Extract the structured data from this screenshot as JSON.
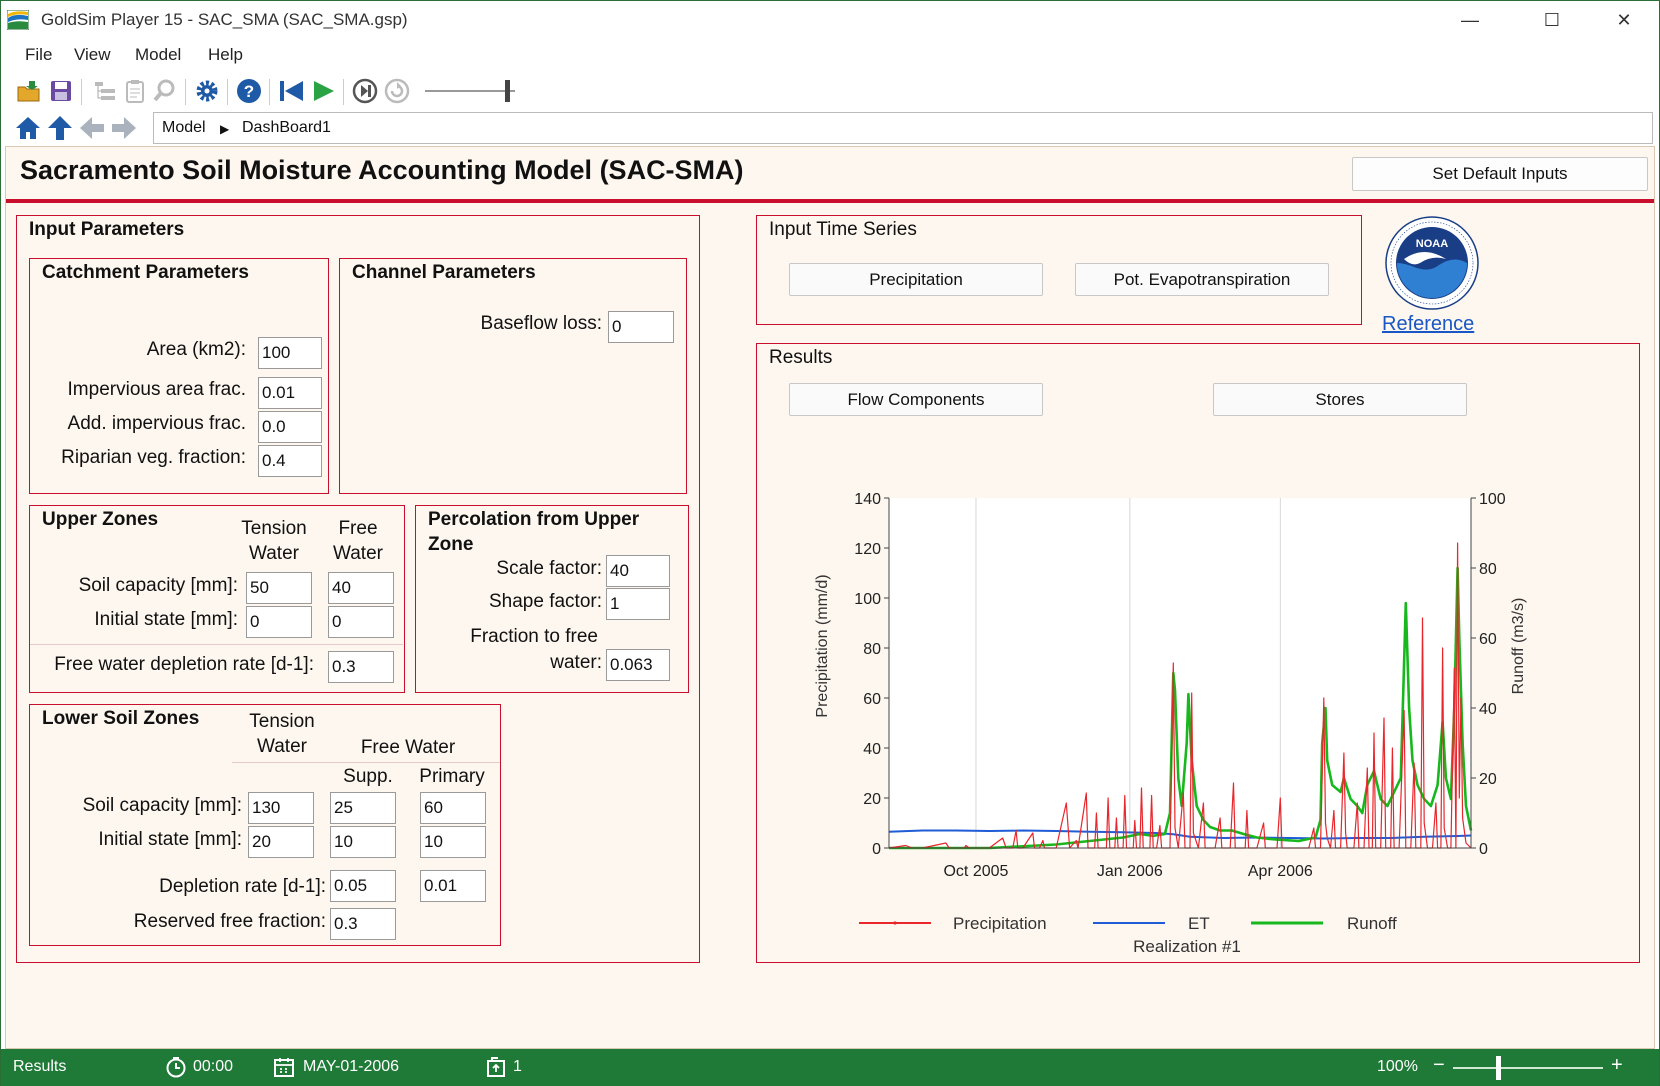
{
  "window": {
    "title": "GoldSim Player 15  - SAC_SMA (SAC_SMA.gsp)",
    "minimize": "—",
    "maximize": "☐",
    "close": "✕"
  },
  "menu": [
    "File",
    "View",
    "Model",
    "Help"
  ],
  "toolbar_icons": [
    "open-folder-icon",
    "save-icon",
    "tree-view-icon",
    "clipboard-icon",
    "search-icon",
    "gear-icon",
    "help-icon",
    "rewind-icon",
    "play-icon",
    "step-icon",
    "reset-icon"
  ],
  "breadcrumb": {
    "root": "Model",
    "separator": "▶",
    "current": "DashBoard1"
  },
  "dashboard": {
    "title": "Sacramento Soil Moisture Accounting Model (SAC-SMA)",
    "set_default_label": "Set Default Inputs",
    "input_parameters": "Input Parameters",
    "catchment": {
      "title": "Catchment Parameters",
      "area_label": "Area (km2):",
      "area": "100",
      "imperv_label": "Impervious area frac.",
      "imperv": "0.01",
      "add_imperv_label": "Add. impervious frac.",
      "add_imperv": "0.0",
      "riparian_label": "Riparian veg. fraction:",
      "riparian": "0.4"
    },
    "channel": {
      "title": "Channel Parameters",
      "baseflow_label": "Baseflow loss:",
      "baseflow": "0"
    },
    "upper": {
      "title": "Upper Zones",
      "col1": "Tension\nWater",
      "col1a": "Tension",
      "col1b": "Water",
      "col2a": "Free",
      "col2b": "Water",
      "soil_label": "Soil capacity [mm]:",
      "soil_tension": "50",
      "soil_free": "40",
      "init_label": "Initial state [mm]:",
      "init_tension": "0",
      "init_free": "0",
      "depl_label": "Free water depletion rate [d-1]:",
      "depl": "0.3"
    },
    "percolation": {
      "title_a": "Percolation from Upper",
      "title_b": "Zone",
      "scale_label": "Scale factor:",
      "scale": "40",
      "shape_label": "Shape factor:",
      "shape": "1",
      "frac_label_a": "Fraction to free",
      "frac_label_b": "water:",
      "frac": "0.063"
    },
    "lower": {
      "title": "Lower Soil Zones",
      "tension_a": "Tension",
      "tension_b": "Water",
      "free_water": "Free Water",
      "supp": "Supp.",
      "primary": "Primary",
      "soil_label": "Soil capacity [mm]:",
      "soil_tension": "130",
      "soil_supp": "25",
      "soil_primary": "60",
      "init_label": "Initial state [mm]:",
      "init_tension": "20",
      "init_supp": "10",
      "init_primary": "10",
      "depl_label": "Depletion rate [d-1]:",
      "depl_supp": "0.05",
      "depl_primary": "0.01",
      "reserved_label": "Reserved free fraction:",
      "reserved": "0.3"
    },
    "time_series": {
      "title": "Input Time Series",
      "precip_button": "Precipitation",
      "pet_button": "Pot. Evapotranspiration"
    },
    "reference_label": "Reference",
    "results": {
      "title": "Results",
      "flow_button": "Flow Components",
      "stores_button": "Stores"
    }
  },
  "chart_data": {
    "type": "line",
    "xlabel": "Realization #1",
    "ylabel": "Precipitation (mm/d)",
    "y2label": "Runoff (m3/s)",
    "ylim": [
      0,
      140
    ],
    "y2lim": [
      0,
      100
    ],
    "y_ticks": [
      "0",
      "20",
      "40",
      "60",
      "80",
      "100",
      "120",
      "140"
    ],
    "y2_ticks": [
      "0",
      "20",
      "40",
      "60",
      "80",
      "100"
    ],
    "x_ticks": [
      {
        "label": "Oct 2005",
        "day": 30
      },
      {
        "label": "Jan 2006",
        "day": 122
      },
      {
        "label": "Apr 2006",
        "day": 212
      }
    ],
    "xlim_days": [
      0,
      242
    ],
    "grid": true,
    "legend_position": "bottom",
    "series": [
      {
        "name": "Precipitation",
        "axis": "left",
        "color": "#e8262b",
        "points": [
          [
            0,
            0
          ],
          [
            10,
            1
          ],
          [
            14,
            0
          ],
          [
            20,
            0
          ],
          [
            34,
            2
          ],
          [
            36,
            0
          ],
          [
            45,
            0
          ],
          [
            46,
            1
          ],
          [
            48,
            0
          ],
          [
            60,
            0
          ],
          [
            68,
            4
          ],
          [
            70,
            0
          ],
          [
            74,
            0
          ],
          [
            76,
            7
          ],
          [
            77,
            0
          ],
          [
            80,
            0
          ],
          [
            86,
            6
          ],
          [
            87,
            0
          ],
          [
            90,
            0
          ],
          [
            92,
            3
          ],
          [
            93,
            0
          ],
          [
            100,
            0
          ],
          [
            106,
            18
          ],
          [
            108,
            0
          ],
          [
            112,
            3
          ],
          [
            113,
            0
          ],
          [
            118,
            22
          ],
          [
            119,
            0
          ],
          [
            123,
            0
          ],
          [
            124,
            14
          ],
          [
            125,
            0
          ],
          [
            130,
            0
          ],
          [
            131,
            20
          ],
          [
            132,
            0
          ],
          [
            135,
            0
          ],
          [
            136,
            12
          ],
          [
            137,
            0
          ],
          [
            140,
            0
          ],
          [
            141,
            21
          ],
          [
            142,
            0
          ],
          [
            146,
            0
          ],
          [
            147,
            11
          ],
          [
            148,
            0
          ],
          [
            150,
            0
          ],
          [
            151,
            24
          ],
          [
            152,
            0
          ],
          [
            156,
            0
          ],
          [
            157,
            21
          ],
          [
            158,
            0
          ],
          [
            160,
            0
          ],
          [
            162,
            9
          ],
          [
            163,
            0
          ],
          [
            168,
            0
          ],
          [
            170,
            74
          ],
          [
            171,
            8
          ],
          [
            173,
            0
          ],
          [
            176,
            22
          ],
          [
            177,
            0
          ],
          [
            180,
            0
          ],
          [
            181,
            62
          ],
          [
            182,
            6
          ],
          [
            185,
            0
          ],
          [
            188,
            18
          ],
          [
            189,
            0
          ],
          [
            195,
            0
          ],
          [
            198,
            12
          ],
          [
            199,
            0
          ],
          [
            204,
            0
          ],
          [
            206,
            26
          ],
          [
            207,
            0
          ],
          [
            213,
            0
          ],
          [
            214,
            15
          ],
          [
            215,
            0
          ],
          [
            220,
            0
          ],
          [
            224,
            10
          ],
          [
            225,
            0
          ],
          [
            232,
            0
          ],
          [
            234,
            20
          ],
          [
            235,
            0
          ],
          [
            240,
            0
          ],
          [
            245,
            0
          ],
          [
            251,
            0
          ],
          [
            254,
            8
          ],
          [
            255,
            0
          ],
          [
            258,
            0
          ],
          [
            260,
            60
          ],
          [
            261,
            10
          ],
          [
            262,
            4
          ],
          [
            264,
            0
          ],
          [
            266,
            15
          ],
          [
            267,
            0
          ],
          [
            270,
            0
          ],
          [
            272,
            38
          ],
          [
            273,
            6
          ],
          [
            274,
            0
          ],
          [
            278,
            0
          ],
          [
            280,
            18
          ],
          [
            281,
            0
          ],
          [
            284,
            0
          ],
          [
            286,
            32
          ],
          [
            287,
            0
          ],
          [
            289,
            0
          ],
          [
            290,
            46
          ],
          [
            291,
            0
          ],
          [
            294,
            0
          ],
          [
            296,
            52
          ],
          [
            297,
            0
          ],
          [
            300,
            0
          ],
          [
            301,
            40
          ],
          [
            302,
            0
          ],
          [
            305,
            0
          ],
          [
            308,
            55
          ],
          [
            309,
            0
          ],
          [
            312,
            0
          ],
          [
            314,
            34
          ],
          [
            315,
            0
          ],
          [
            318,
            0
          ],
          [
            319,
            92
          ],
          [
            320,
            10
          ],
          [
            322,
            0
          ],
          [
            325,
            0
          ],
          [
            327,
            18
          ],
          [
            328,
            0
          ],
          [
            330,
            0
          ],
          [
            331,
            80
          ],
          [
            332,
            8
          ],
          [
            334,
            0
          ],
          [
            336,
            0
          ],
          [
            338,
            72
          ],
          [
            339,
            0
          ],
          [
            340,
            122
          ],
          [
            341,
            20
          ],
          [
            342,
            60
          ],
          [
            343,
            12
          ],
          [
            345,
            2
          ],
          [
            348,
            0
          ]
        ]
      },
      {
        "name": "ET",
        "axis": "left",
        "color": "#1f5cd6",
        "points": [
          [
            0,
            6.5
          ],
          [
            20,
            7
          ],
          [
            40,
            7
          ],
          [
            60,
            6.8
          ],
          [
            80,
            7
          ],
          [
            100,
            6.8
          ],
          [
            120,
            6.5
          ],
          [
            140,
            6.3
          ],
          [
            160,
            6.0
          ],
          [
            170,
            5.5
          ],
          [
            180,
            4.5
          ],
          [
            200,
            4
          ],
          [
            220,
            4.2
          ],
          [
            240,
            4
          ],
          [
            260,
            3.8
          ],
          [
            280,
            4
          ],
          [
            300,
            4
          ],
          [
            320,
            4.5
          ],
          [
            340,
            4.8
          ],
          [
            348,
            5
          ]
        ]
      },
      {
        "name": "Runoff",
        "axis": "right",
        "color": "#17b81d",
        "points": [
          [
            0,
            0
          ],
          [
            60,
            0
          ],
          [
            80,
            0.5
          ],
          [
            100,
            1
          ],
          [
            120,
            2
          ],
          [
            140,
            3
          ],
          [
            150,
            4
          ],
          [
            158,
            3.5
          ],
          [
            165,
            4
          ],
          [
            168,
            10
          ],
          [
            170,
            50
          ],
          [
            171,
            45
          ],
          [
            173,
            20
          ],
          [
            175,
            12
          ],
          [
            178,
            30
          ],
          [
            179,
            44
          ],
          [
            181,
            25
          ],
          [
            184,
            12
          ],
          [
            188,
            8
          ],
          [
            192,
            6
          ],
          [
            198,
            5
          ],
          [
            205,
            5
          ],
          [
            212,
            4
          ],
          [
            220,
            3
          ],
          [
            230,
            2.5
          ],
          [
            245,
            2
          ],
          [
            255,
            3
          ],
          [
            258,
            8
          ],
          [
            259,
            30
          ],
          [
            261,
            40
          ],
          [
            262,
            25
          ],
          [
            265,
            18
          ],
          [
            270,
            16
          ],
          [
            272,
            20
          ],
          [
            276,
            14
          ],
          [
            280,
            12
          ],
          [
            283,
            10
          ],
          [
            286,
            18
          ],
          [
            290,
            22
          ],
          [
            294,
            14
          ],
          [
            298,
            12
          ],
          [
            302,
            16
          ],
          [
            306,
            20
          ],
          [
            309,
            70
          ],
          [
            311,
            40
          ],
          [
            313,
            25
          ],
          [
            316,
            18
          ],
          [
            320,
            14
          ],
          [
            324,
            12
          ],
          [
            328,
            18
          ],
          [
            331,
            36
          ],
          [
            333,
            20
          ],
          [
            336,
            14
          ],
          [
            338,
            40
          ],
          [
            340,
            80
          ],
          [
            341,
            60
          ],
          [
            343,
            30
          ],
          [
            345,
            12
          ],
          [
            348,
            5
          ]
        ]
      }
    ]
  },
  "status": {
    "left": "Results",
    "time": "00:00",
    "date": "MAY-01-2006",
    "realization": "1",
    "zoom": "100%"
  },
  "colors": {
    "accent_red": "#c8102e",
    "status_green": "#1f7a37",
    "panel_bg": "#fdf7ef",
    "link_blue": "#1a56c4"
  }
}
